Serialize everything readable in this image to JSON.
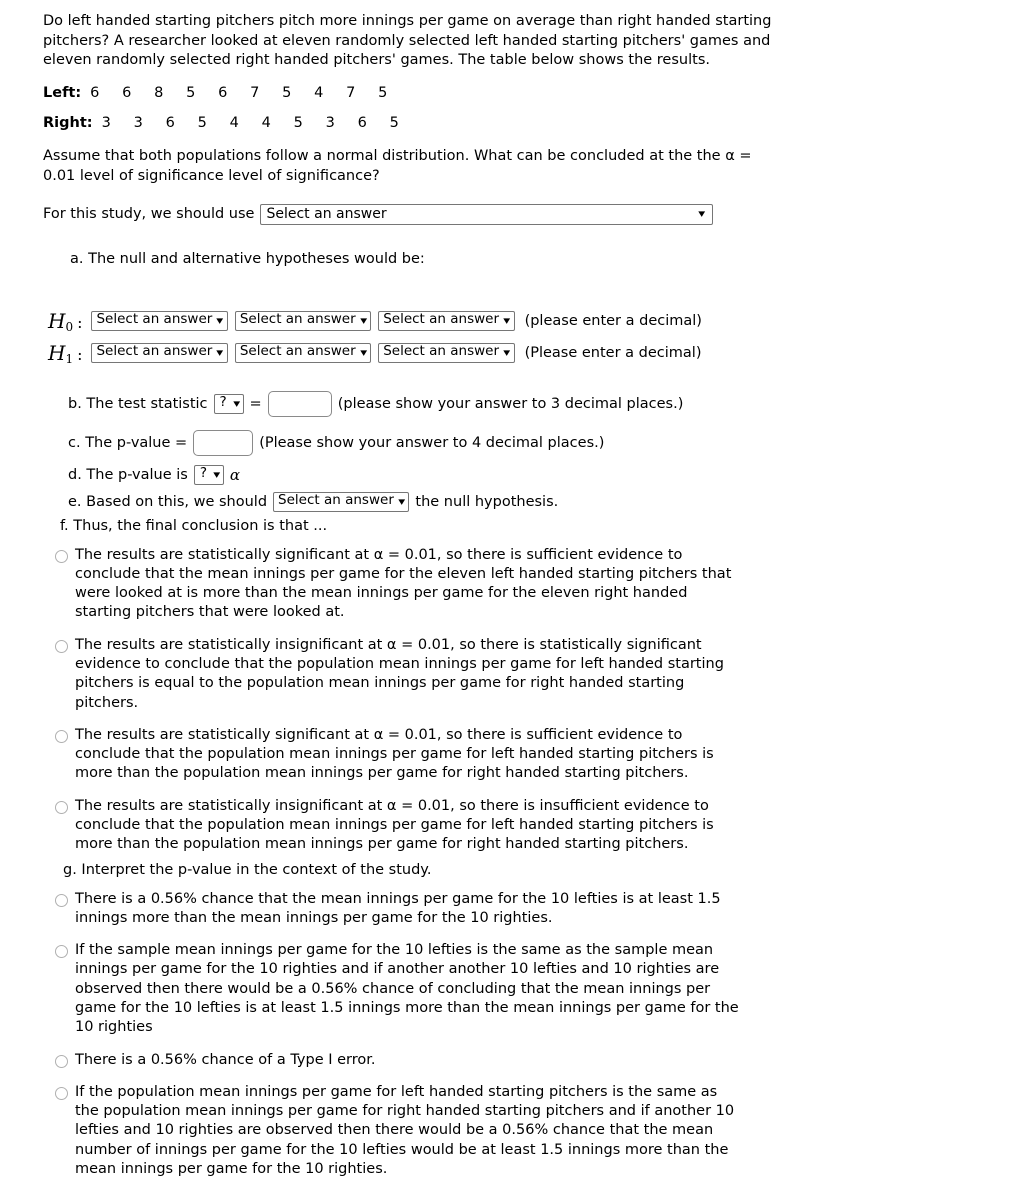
{
  "intro": {
    "paragraph": "Do left handed starting pitchers pitch more innings per game on average than right handed starting pitchers?  A researcher looked at eleven randomly selected left handed starting pitchers' games and eleven randomly selected right handed pitchers' games. The table below shows the results."
  },
  "data_table": {
    "left_label": "Left:",
    "left_values": [
      "6",
      "6",
      "8",
      "5",
      "6",
      "7",
      "5",
      "4",
      "7",
      "5"
    ],
    "right_label": "Right:",
    "right_values": [
      "3",
      "3",
      "6",
      "5",
      "4",
      "4",
      "5",
      "3",
      "6",
      "5"
    ]
  },
  "assumption": {
    "text": "Assume that both populations follow a normal distribution.  What can be concluded at the the α = 0.01 level of significance level of significance?"
  },
  "study": {
    "prompt": "For this study, we should use",
    "select_value": "Select an answer"
  },
  "item_a": {
    "label": "a. The null and alternative hypotheses would be:"
  },
  "hypotheses": {
    "h0": {
      "symbol": "H",
      "subscript": "0",
      "colon": ":",
      "select1": "Select an answer",
      "select2": "Select an answer",
      "select3": "Select an answer",
      "note": "(please enter a decimal)"
    },
    "h1": {
      "symbol": "H",
      "subscript": "1",
      "colon": ":",
      "select1": "Select an answer",
      "select2": "Select an answer",
      "select3": "Select an answer",
      "note": "(Please enter a decimal)"
    }
  },
  "item_b": {
    "label": "b. The test statistic",
    "select_value": "?",
    "equals": "=",
    "input_value": "",
    "note": "(please show your answer to 3 decimal places.)"
  },
  "item_c": {
    "label": "c. The p-value =",
    "input_value": "",
    "note": "(Please show your answer to 4 decimal places.)"
  },
  "item_d": {
    "label": "d. The p-value is",
    "select_value": "?",
    "alpha": "α"
  },
  "item_e": {
    "label_before": "e. Based on this, we should",
    "select_value": "Select an answer",
    "label_after": "the null hypothesis."
  },
  "item_f": {
    "label": "f. Thus, the final conclusion is that ...",
    "options": [
      "The results are statistically significant at α = 0.01, so there is sufficient evidence to conclude that the mean innings per game for the eleven left handed starting pitchers that were looked at is more than the mean innings per game for the eleven right handed starting pitchers that were looked at.",
      "The results are statistically insignificant at α = 0.01, so there is statistically significant evidence to conclude that the population mean innings per game for left handed starting pitchers is equal to the population mean innings per game for right handed starting pitchers.",
      "The results are statistically significant at α = 0.01, so there is sufficient evidence to conclude that the population mean innings per game for left handed starting pitchers is more than the population mean innings per game for right handed starting pitchers.",
      "The results are statistically insignificant at α = 0.01, so there is insufficient evidence to conclude that the population mean innings per game for left handed starting pitchers is more than the population mean innings per game for right handed starting pitchers."
    ]
  },
  "item_g": {
    "label": "g. Interpret the p-value in the context of the study.",
    "options": [
      "There is a 0.56% chance that the mean innings per game for the 10 lefties is at least 1.5 innings more than the mean innings per game for the 10 righties.",
      "If the sample mean innings per game for the 10 lefties is the same as the sample mean innings per game for the 10 righties and if another another 10 lefties and 10 righties are observed then there would be a 0.56% chance of concluding that the mean innings per game for the 10 lefties is at least 1.5 innings more than the mean innings per game for the 10 righties",
      "There is a 0.56% chance of a Type I error.",
      "If the population mean innings per game for left handed starting pitchers is the same as the population mean innings per game for right handed starting pitchers and if another 10 lefties and 10 righties are observed then there would be a 0.56% chance that the mean number of innings per game for the 10 lefties would be at least 1.5 innings more than the mean innings per game for the 10 righties."
    ]
  },
  "icons": {
    "chevron_down": "⌄"
  }
}
